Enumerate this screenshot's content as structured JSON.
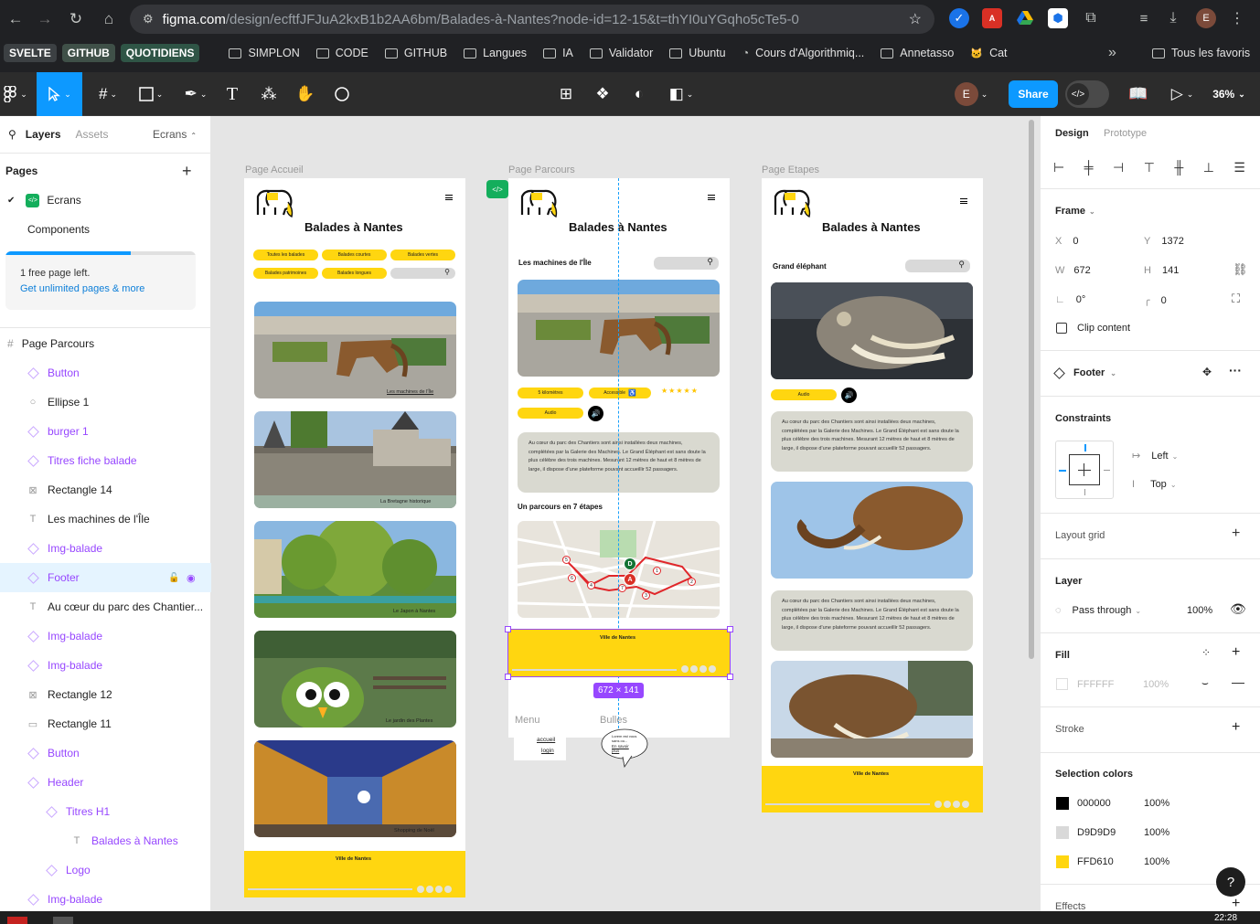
{
  "browser": {
    "url_host": "figma.com",
    "url_path": "/design/ecftfJFJuA2kxB1b2AA6bm/Balades-à-Nantes?node-id=12-15&t=thYI0uYGqho5cTe5-0",
    "profile_initial": "E",
    "bookmarks": {
      "pills": [
        "SVELTE",
        "GITHUB",
        "QUOTIDIENS"
      ],
      "pill_colors": [
        "#3c4043",
        "#3f5048",
        "#2f5546"
      ],
      "items": [
        "SIMPLON",
        "CODE",
        "GITHUB",
        "Langues",
        "IA",
        "Validator",
        "Ubuntu",
        "Cours d'Algorithmiq...",
        "Annetasso",
        "Cat"
      ],
      "overflow": "»",
      "all": "Tous les favoris"
    }
  },
  "toolbar": {
    "user_initial": "E",
    "share_label": "Share",
    "zoom": "36%"
  },
  "left_panel": {
    "tabs": [
      "Layers",
      "Assets"
    ],
    "page_select": "Ecrans",
    "pages_title": "Pages",
    "pages": [
      "Ecrans",
      "Components"
    ],
    "upgrade_text": "1 free page left.",
    "upgrade_link": "Get unlimited pages & more",
    "frame_name": "Page Parcours",
    "layers": [
      {
        "name": "Button",
        "icon": "component-icon",
        "purple": true
      },
      {
        "name": "Ellipse 1",
        "icon": "ellipse-icon",
        "purple": false
      },
      {
        "name": "burger 1",
        "icon": "component-icon",
        "purple": true
      },
      {
        "name": "Titres fiche balade",
        "icon": "component-icon",
        "purple": true
      },
      {
        "name": "Rectangle 14",
        "icon": "image-icon",
        "purple": false
      },
      {
        "name": "Les machines de l'Île",
        "icon": "text-icon",
        "purple": false
      },
      {
        "name": "Img-balade",
        "icon": "component-icon",
        "purple": true
      },
      {
        "name": "Footer",
        "icon": "component-icon",
        "purple": true,
        "selected": true
      },
      {
        "name": "Au cœur du parc des Chantier...",
        "icon": "text-icon",
        "purple": false
      },
      {
        "name": "Img-balade",
        "icon": "component-icon",
        "purple": true
      },
      {
        "name": "Img-balade",
        "icon": "component-icon",
        "purple": true
      },
      {
        "name": "Rectangle 12",
        "icon": "image-icon",
        "purple": false
      },
      {
        "name": "Rectangle 11",
        "icon": "rect-icon",
        "purple": false
      },
      {
        "name": "Button",
        "icon": "component-icon",
        "purple": true
      },
      {
        "name": "Header",
        "icon": "component-icon",
        "purple": true
      },
      {
        "name": "Titres H1",
        "icon": "component-icon",
        "purple": true
      },
      {
        "name": "Balades à Nantes",
        "icon": "text-icon",
        "purple": true
      },
      {
        "name": "Logo",
        "icon": "component-icon",
        "purple": true
      },
      {
        "name": "Img-balade",
        "icon": "component-icon",
        "purple": true
      }
    ]
  },
  "canvas": {
    "frames": [
      "Page Accueil",
      "Page Parcours",
      "Page Etapes"
    ],
    "site_title": "Balades à Nantes",
    "accueil": {
      "filters_row1": [
        "Toutes les balades",
        "Balades courtes",
        "Balades vertes"
      ],
      "filters_row2": [
        "Balades patrimoines",
        "Balades longues"
      ],
      "cards": [
        "Les machines de l'Île",
        "La Bretagne historique",
        "Le Japon à Nantes",
        "Le jardin des Plantes",
        "Shopping de Noël"
      ]
    },
    "parcours": {
      "heading": "Les machines de l'Île",
      "chip_distance": "5 kilomètres",
      "chip_access": "Accessible",
      "stars": "★★★★★",
      "chip_audio": "Audio",
      "text": "Au cœur du parc des Chantiers sont ainsi installées deux machines, complétées par la Galerie des Machines. Le Grand Éléphant est sans doute la plus célèbre des trois machines. Mesurant 12 mètres de haut et 8 mètres de large, il dispose d'une plateforme pouvant accueillir 52 passagers.",
      "route_heading": "Un parcours en 7 étapes",
      "map_start": "D",
      "map_end": "A",
      "map_stops": [
        "1",
        "2",
        "3",
        "4",
        "5",
        "6",
        "7"
      ]
    },
    "etapes": {
      "heading": "Grand éléphant",
      "chip_audio": "Audio",
      "text": "Au cœur du parc des Chantiers sont ainsi installées deux machines, complétées par la Galerie des Machines. Le Grand Éléphant est sans doute la plus célèbre des trois machines. Mesurant 12 mètres de haut et 8 mètres de large, il dispose d'une plateforme pouvant accueillir 52 passagers."
    },
    "footer_title": "Ville de Nantes",
    "selection_size": "672 × 141",
    "menu_label": "Menu",
    "menu_items": [
      "accueil",
      "login"
    ],
    "bubbles_label": "Bulles",
    "bubble_text": [
      "Lorem est vous",
      "sans ou...",
      "En savoir",
      "plus"
    ]
  },
  "right_panel": {
    "tabs": [
      "Design",
      "Prototype"
    ],
    "frame_label": "Frame",
    "x_label": "X",
    "x": "0",
    "y_label": "Y",
    "y": "1372",
    "w_label": "W",
    "w": "672",
    "h_label": "H",
    "h": "141",
    "rotation": "0°",
    "radius": "0",
    "clip_content": "Clip content",
    "component_name": "Footer",
    "constraints_title": "Constraints",
    "constraint_h": "Left",
    "constraint_v": "Top",
    "layout_grid": "Layout grid",
    "layer_title": "Layer",
    "blend": "Pass through",
    "layer_opacity": "100%",
    "fill_title": "Fill",
    "fill_hex": "FFFFFF",
    "fill_opacity": "100%",
    "stroke_title": "Stroke",
    "selection_colors_title": "Selection colors",
    "selection_colors": [
      {
        "hex": "000000",
        "opacity": "100%",
        "swatch": "#000000"
      },
      {
        "hex": "D9D9D9",
        "opacity": "100%",
        "swatch": "#d9d9d9"
      },
      {
        "hex": "FFD610",
        "opacity": "100%",
        "swatch": "#ffd610"
      }
    ],
    "effects_title": "Effects",
    "help": "?"
  },
  "taskbar": {
    "time": "22:28"
  },
  "colors": {
    "accent": "#0d99ff",
    "selection": "#9747ff",
    "brand_yellow": "#ffd610",
    "toolbar": "#2c2c2c"
  }
}
